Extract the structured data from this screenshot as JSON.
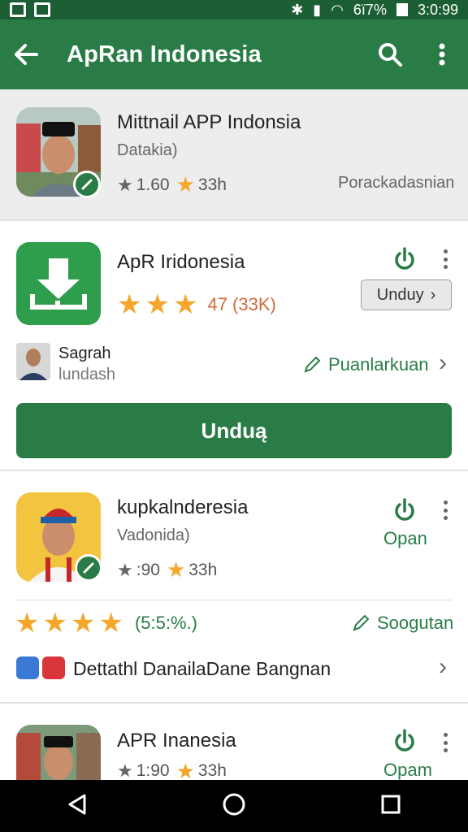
{
  "status_bar": {
    "battery": "6ï7%",
    "time": "3:0:99"
  },
  "app_bar": {
    "title": "ApRan Indonesia"
  },
  "items": [
    {
      "title": "Mittnail APP Indonsia",
      "subtitle": "Datakia)",
      "rating": "1.60",
      "time": "33h",
      "right_text": "Porackadasnian"
    },
    {
      "title": "ApR Iridonesia",
      "rating_text": "47 (33K)",
      "small_button": "Unduy",
      "author_name": "Sagrah",
      "author_sub": "lundash",
      "link": "Puanlarkuan",
      "big_button": "Unduą"
    },
    {
      "title": "kupkalnderesia",
      "subtitle": "Vadonida)",
      "rating": ":90",
      "time": "33h",
      "action": "Opan",
      "percent": "(5:5:%.)",
      "link": "Soogutan",
      "footer": "Dettathl DanailaDane Bangnan"
    },
    {
      "title": "APR Inanesia",
      "rating": "1:90",
      "time": "33h",
      "action": "Opam"
    }
  ],
  "colors": {
    "primary": "#2a7c47",
    "status": "#1b5e33",
    "star": "#f4a72a"
  }
}
